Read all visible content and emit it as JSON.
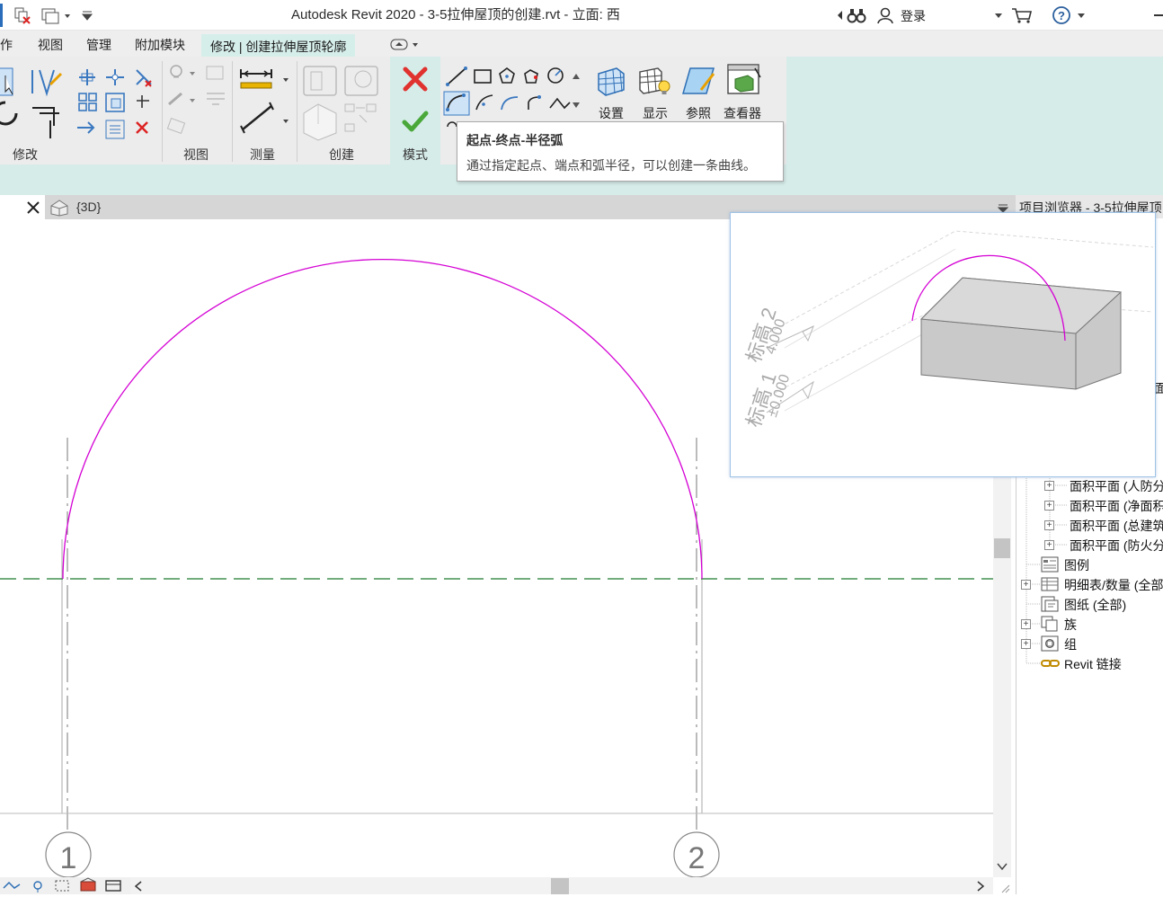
{
  "titlebar": {
    "title": "Autodesk Revit 2020 - 3-5拉伸屋顶的创建.rvt - 立面: 西",
    "login_label": "登录"
  },
  "tabs": {
    "partial_left": "作",
    "items": [
      "视图",
      "管理",
      "附加模块"
    ],
    "active": "修改 | 创建拉伸屋顶轮廓"
  },
  "ribbon": {
    "panels": [
      "修改",
      "视图",
      "测量",
      "创建",
      "模式"
    ],
    "buttons": [
      "设置",
      "显示",
      "参照",
      "查看器"
    ]
  },
  "tooltip": {
    "title": "起点-终点-半径弧",
    "description": "通过指定起点、端点和弧半径，可以创建一条曲线。"
  },
  "view_tab": {
    "label": "{3D}"
  },
  "canvas": {
    "grid_labels": [
      "1",
      "2"
    ],
    "preview": {
      "level_labels": [
        "标高 2",
        "标高 1"
      ],
      "level_values": [
        "4.000",
        "±0.000"
      ]
    }
  },
  "browser": {
    "title": "项目浏览器 - 3-5拉伸屋顶",
    "partial_item": "面)",
    "items": [
      {
        "label": "面积平面 (人防分",
        "expandable": true
      },
      {
        "label": "面积平面 (净面积",
        "expandable": true
      },
      {
        "label": "面积平面 (总建筑",
        "expandable": true
      },
      {
        "label": "面积平面 (防火分",
        "expandable": true
      },
      {
        "label": "图例",
        "expandable": false
      },
      {
        "label": "明细表/数量 (全部",
        "expandable": true
      },
      {
        "label": "图纸 (全部)",
        "expandable": false
      },
      {
        "label": "族",
        "expandable": true
      },
      {
        "label": "组",
        "expandable": true
      },
      {
        "label": "Revit 链接",
        "expandable": false
      }
    ]
  },
  "colors": {
    "accent": "#d6ece9",
    "arc": "#d400d4",
    "level_line": "#1f7a2e"
  }
}
